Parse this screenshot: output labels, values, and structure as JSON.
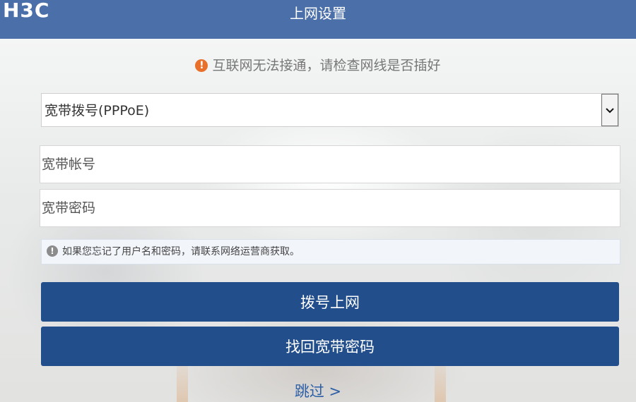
{
  "header": {
    "logo": "H3C",
    "title": "上网设置"
  },
  "status": {
    "message": "互联网无法接通，请检查网线是否插好",
    "icon": "warning-icon",
    "icon_color": "#e8702a"
  },
  "connection_type": {
    "selected": "宽带拨号(PPPoE)"
  },
  "username": {
    "placeholder": "宽带帐号",
    "value": ""
  },
  "password": {
    "placeholder": "宽带密码",
    "value": ""
  },
  "hint": {
    "icon": "info-icon",
    "text": "如果您忘记了用户名和密码，请联系网络运营商获取。"
  },
  "buttons": {
    "dial": "拨号上网",
    "recover": "找回宽带密码"
  },
  "skip": {
    "label": "跳过 >"
  },
  "colors": {
    "header": "#4a6fa9",
    "primary_button": "#224f8c",
    "link": "#2d5fa6"
  }
}
